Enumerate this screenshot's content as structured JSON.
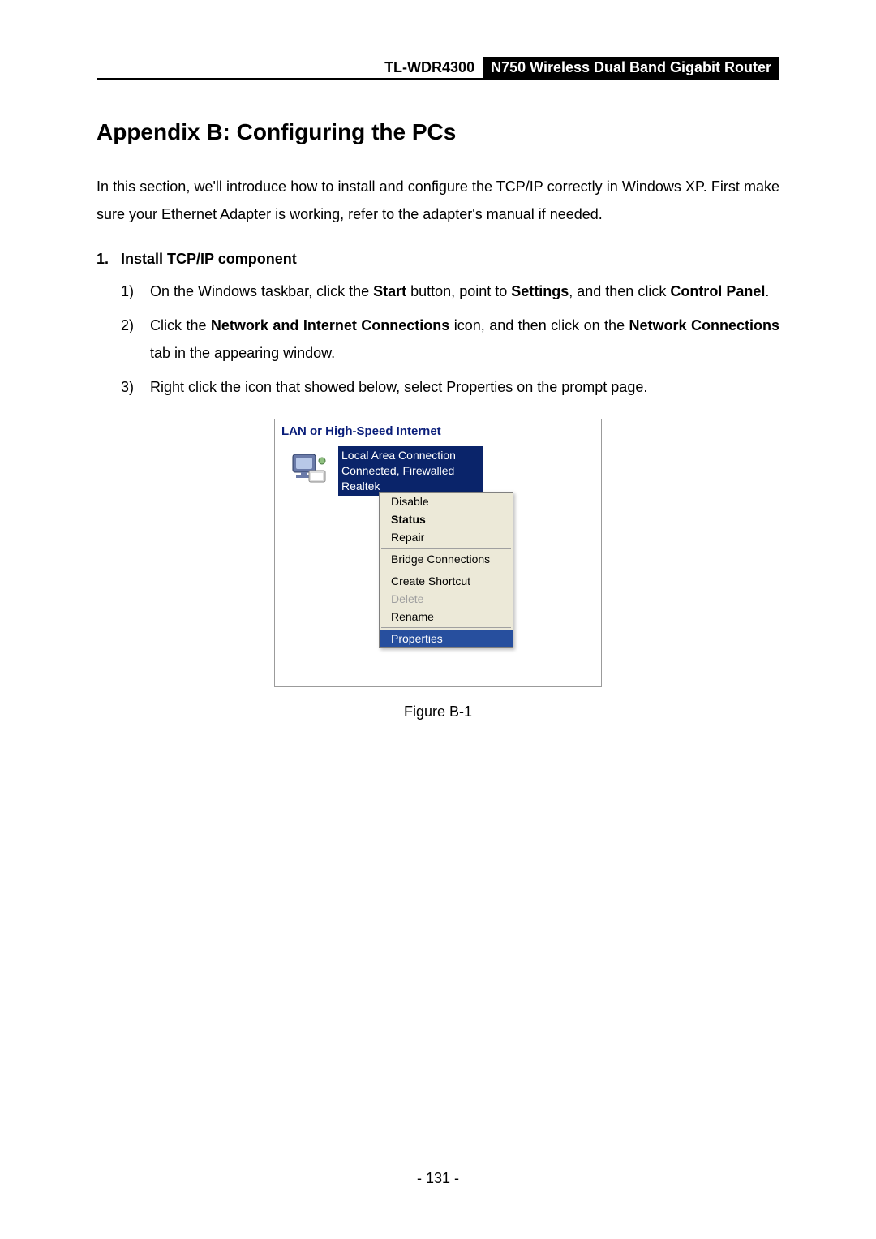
{
  "header": {
    "model": "TL-WDR4300",
    "product": "N750 Wireless Dual Band Gigabit Router"
  },
  "title": "Appendix B: Configuring the PCs",
  "intro": "In this section, we'll introduce how to install and configure the TCP/IP correctly in Windows XP. First make sure your Ethernet Adapter is working, refer to the adapter's manual if needed.",
  "section": {
    "num": "1.",
    "heading": "Install TCP/IP component"
  },
  "steps": {
    "s1": {
      "num": "1)",
      "t0": "On the Windows taskbar, click the ",
      "b0": "Start",
      "t1": " button, point to ",
      "b1": "Settings",
      "t2": ", and then click ",
      "b2": "Control Panel",
      "t3": "."
    },
    "s2": {
      "num": "2)",
      "t0": "Click the ",
      "b0": "Network and Internet Connections",
      "t1": " icon, and then click on the ",
      "b1": "Network Connections",
      "t2": " tab in the appearing window."
    },
    "s3": {
      "num": "3)",
      "t0": "Right click the icon that showed below, select Properties on the prompt page."
    }
  },
  "figure": {
    "caption": "Figure B-1",
    "panel_title": "LAN or High-Speed Internet",
    "conn": {
      "line1": "Local Area Connection",
      "line2": "Connected, Firewalled",
      "line3": "Realtek "
    },
    "menu": {
      "disable": "Disable",
      "status": "Status",
      "repair": "Repair",
      "bridge": "Bridge Connections",
      "shortcut": "Create Shortcut",
      "delete": "Delete",
      "rename": "Rename",
      "properties": "Properties"
    }
  },
  "page_number": "- 131 -"
}
